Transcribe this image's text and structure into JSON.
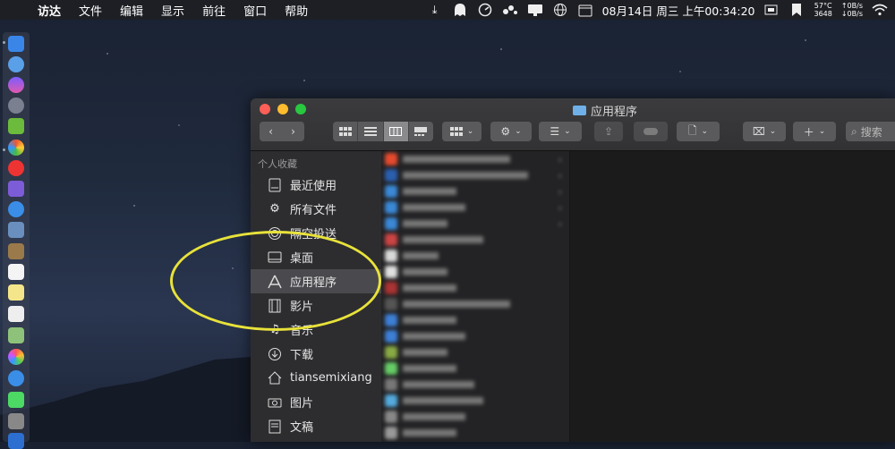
{
  "menubar": {
    "apple": "",
    "items": [
      "访达",
      "文件",
      "编辑",
      "显示",
      "前往",
      "窗口",
      "帮助"
    ],
    "status": {
      "datetime": "08月14日 周三 上午00:34:20",
      "temp": "57°C",
      "fan": "3648",
      "net_up": "↑0B/s",
      "net_down": "↓0B/s"
    }
  },
  "window": {
    "title": "应用程序",
    "search_placeholder": "搜索",
    "sidebar_header": "个人收藏",
    "sidebar": [
      {
        "label": "最近使用",
        "icon": "recents-icon"
      },
      {
        "label": "所有文件",
        "icon": "gear-icon"
      },
      {
        "label": "隔空投送",
        "icon": "airdrop-icon"
      },
      {
        "label": "桌面",
        "icon": "desktop-icon"
      },
      {
        "label": "应用程序",
        "icon": "applications-icon",
        "selected": true
      },
      {
        "label": "影片",
        "icon": "film-icon"
      },
      {
        "label": "音乐",
        "icon": "music-icon"
      },
      {
        "label": "下载",
        "icon": "download-icon"
      },
      {
        "label": "tiansemixiang",
        "icon": "home-icon"
      },
      {
        "label": "图片",
        "icon": "camera-icon"
      },
      {
        "label": "文稿",
        "icon": "documents-icon"
      }
    ]
  },
  "colors": {
    "selection": "#4a4a4e",
    "highlight_ellipse": "#e8e23a",
    "close": "#fe5f57",
    "minimize": "#febc2e",
    "zoom": "#28c840"
  }
}
